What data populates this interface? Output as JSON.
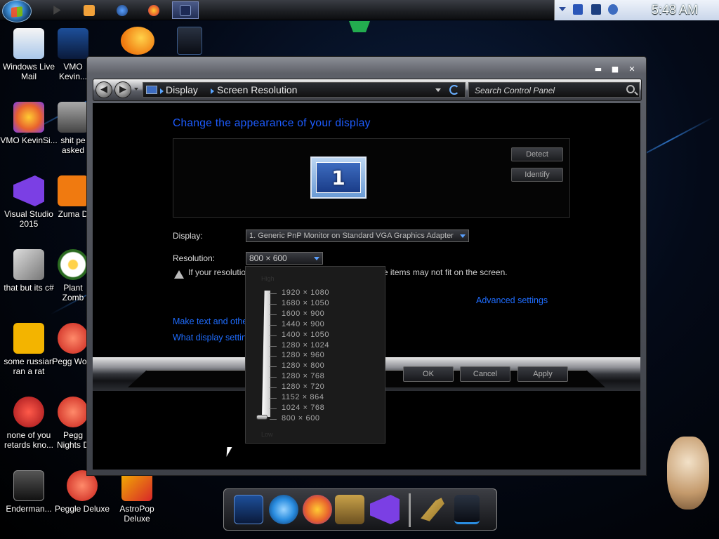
{
  "taskbar": {
    "clock": "5:48 AM",
    "apps": [
      {
        "icon": "media-player-icon",
        "color": "#222222"
      },
      {
        "icon": "video-player-icon",
        "color": "#f2a23a"
      },
      {
        "icon": "globe-icon",
        "color": "#2f6fb0"
      },
      {
        "icon": "firefox-icon",
        "color": "#e8622d"
      },
      {
        "icon": "display-settings-icon",
        "color": "#3654a8"
      }
    ]
  },
  "desktop_icons": [
    {
      "label": "Windows Live Mail",
      "color": "#cfe3f7"
    },
    {
      "label": "VMO KevinSi...",
      "color": "#7a3cf0"
    },
    {
      "label": "Visual Studio 2015",
      "color": "#7b3fe4"
    },
    {
      "label": "that but its c#",
      "color": "#b9b9b9"
    },
    {
      "label": "some russian ran a rat",
      "color": "#f3b400"
    },
    {
      "label": "none of you retards kno...",
      "color": "#d8262a"
    },
    {
      "label": "Enderman...",
      "color": "#444444"
    },
    {
      "label": "VMO Kevin...",
      "color": "#2a6fd6"
    },
    {
      "label": "shit pe asked",
      "color": "#888888"
    },
    {
      "label": "Zuma D",
      "color": "#f07a10"
    },
    {
      "label": "Plant Zomb",
      "color": "#f5f5f5"
    },
    {
      "label": "Pegg Work",
      "color": "#e84b3a"
    },
    {
      "label": "Pegg Nights D",
      "color": "#e84b3a"
    },
    {
      "label": "Peggle Deluxe",
      "color": "#e84b3a"
    },
    {
      "label": "AstroPop Deluxe",
      "color": "#f3b400"
    }
  ],
  "window": {
    "controls": {
      "minimize": "▬",
      "maximize": "■",
      "close": "✕"
    },
    "breadcrumb": [
      "Display",
      "Screen Resolution"
    ],
    "search_placeholder": "Search Control Panel",
    "title": "Change the appearance of your display",
    "detect": "Detect",
    "identify": "Identify",
    "monitor_number": "1",
    "display_label": "Display:",
    "display_value": "1. Generic PnP Monitor on Standard VGA Graphics Adapter",
    "resolution_label": "Resolution:",
    "resolution_value": "800 × 600",
    "warning": "If your resolution is set to less than 1024 × 768, some items may not fit on the screen.",
    "advanced": "Advanced settings",
    "link1": "Make text and other items larger or smaller",
    "link2": "What display settings should I choose?",
    "ok": "OK",
    "cancel": "Cancel",
    "apply": "Apply"
  },
  "resolution_dropdown": {
    "high_label": "High",
    "low_label": "Low",
    "options": [
      "1920 × 1080",
      "1680 × 1050",
      "1600 × 900",
      "1440 × 900",
      "1400 × 1050",
      "1280 × 1024",
      "1280 × 960",
      "1280 × 800",
      "1280 × 768",
      "1280 × 720",
      "1152 × 864",
      "1024 × 768",
      "800 × 600"
    ],
    "selected": "800 × 600"
  },
  "dock": [
    {
      "icon": "monitor-icon",
      "color": "#1d4f9a"
    },
    {
      "icon": "network-globe-icon",
      "color": "#2a8de0"
    },
    {
      "icon": "firefox-icon",
      "color": "#e8622d"
    },
    {
      "icon": "box-app-icon",
      "color": "#9a7b3a"
    },
    {
      "icon": "visual-studio-icon",
      "color": "#7b3fe4"
    },
    {
      "icon": "tools-icon",
      "color": "#c9a24a"
    },
    {
      "icon": "trash-bin-icon",
      "color": "#222a36"
    }
  ]
}
